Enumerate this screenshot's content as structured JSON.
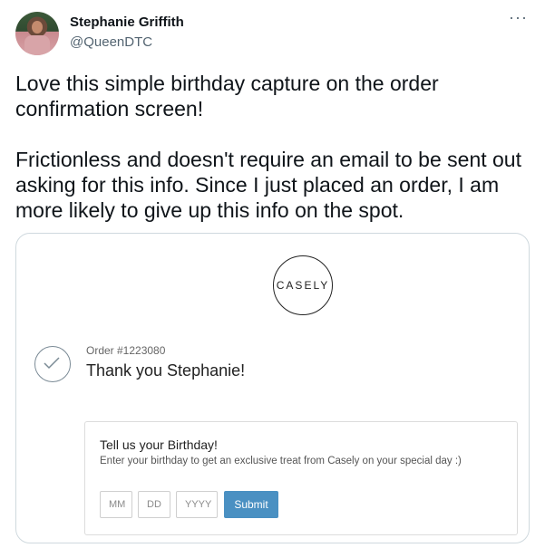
{
  "user": {
    "name": "Stephanie Griffith",
    "handle": "@QueenDTC"
  },
  "more_label": "···",
  "tweet": {
    "text": "Love this simple birthday capture on the order confirmation screen!\n\nFrictionless and doesn't require an email to be sent out asking for this info. Since I just placed an order, I am more likely to give up this info on the spot."
  },
  "card": {
    "logo_text": "CASELY",
    "order_number": "Order #1223080",
    "thank_you": "Thank you Stephanie!",
    "birthday": {
      "title": "Tell us your Birthday!",
      "description": "Enter your birthday to get an exclusive treat from Casely on your special day :)",
      "mm_placeholder": "MM",
      "dd_placeholder": "DD",
      "yyyy_placeholder": "YYYY",
      "submit_label": "Submit"
    }
  },
  "colors": {
    "submit_button": "#4a90c2",
    "card_border": "#cfd9de",
    "handle_text": "#536471"
  }
}
